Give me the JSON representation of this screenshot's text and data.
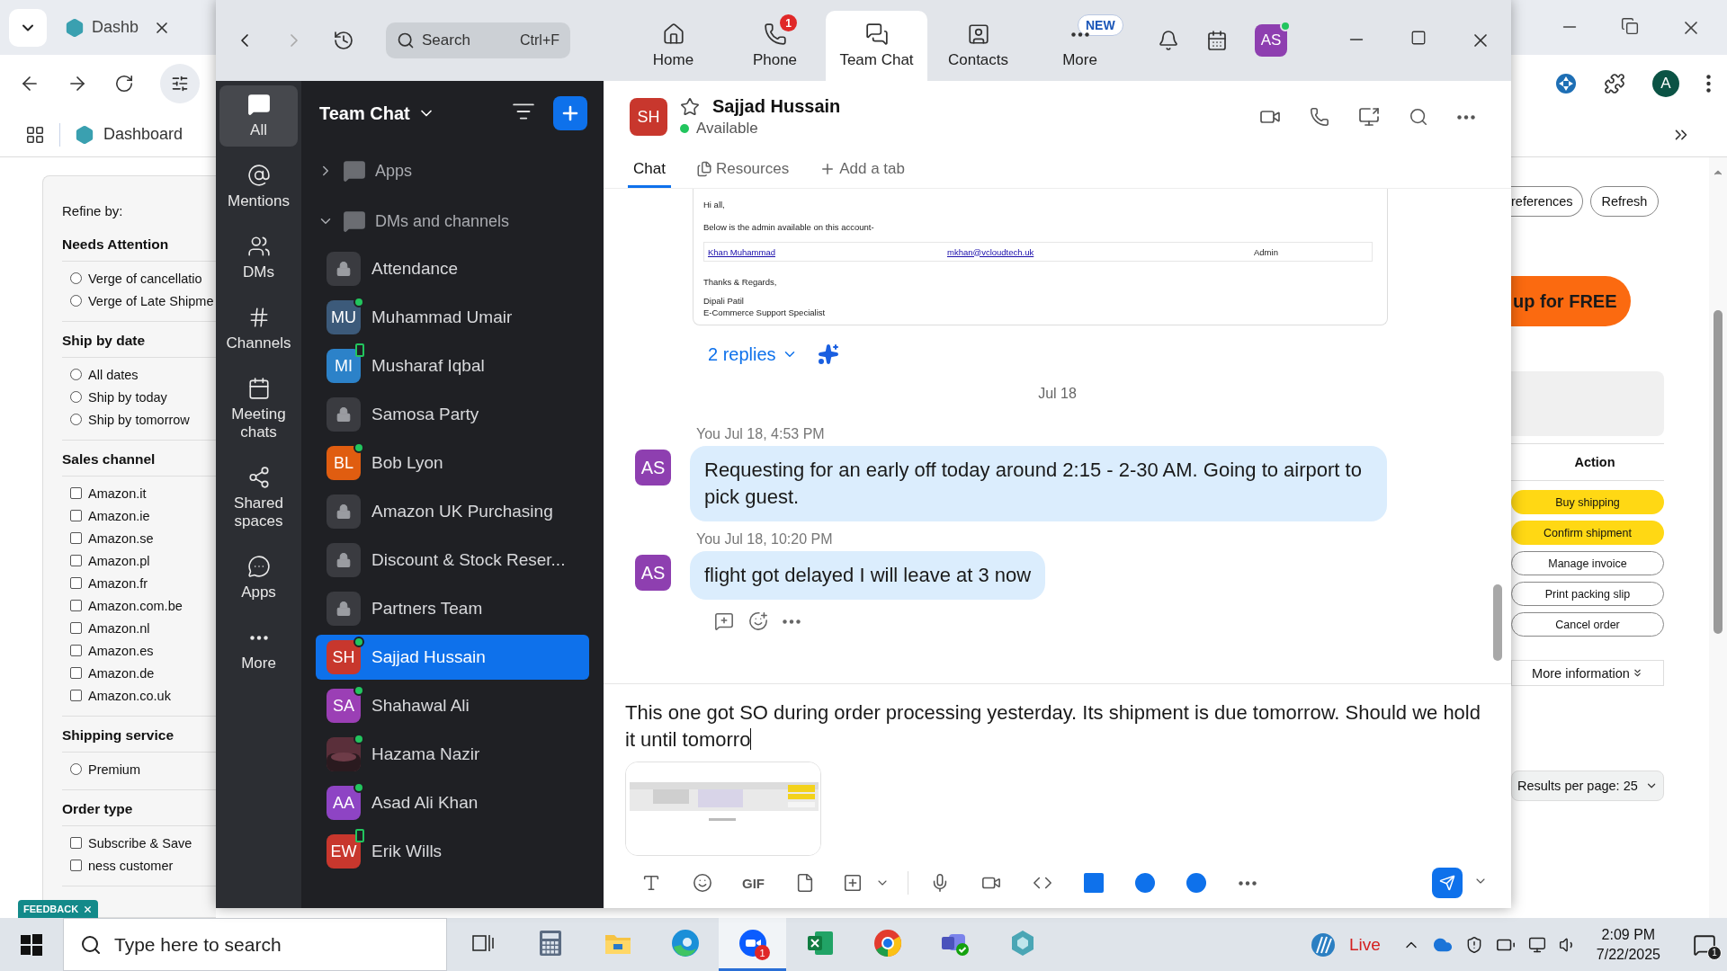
{
  "browser": {
    "tab_title": "Dashb",
    "bookmark": "Dashboard",
    "profile": "A",
    "refine": {
      "title": "Refine by:",
      "sections": [
        {
          "title": "Needs Attention",
          "kind": "radio",
          "options": [
            {
              "label": "Verge of cancellatio",
              "checked": false
            },
            {
              "label": "Verge of Late Shipme",
              "checked": false
            }
          ]
        },
        {
          "title": "Ship by date",
          "kind": "radio",
          "options": [
            {
              "label": "All dates",
              "checked": false
            },
            {
              "label": "Ship by today",
              "checked": false
            },
            {
              "label": "Ship by tomorrow",
              "checked": false
            }
          ]
        },
        {
          "title": "Sales channel",
          "kind": "checkbox",
          "options": [
            {
              "label": "Amazon.it",
              "checked": false
            },
            {
              "label": "Amazon.ie",
              "checked": false
            },
            {
              "label": "Amazon.se",
              "checked": false
            },
            {
              "label": "Amazon.pl",
              "checked": false
            },
            {
              "label": "Amazon.fr",
              "checked": false
            },
            {
              "label": "Amazon.com.be",
              "checked": false
            },
            {
              "label": "Amazon.nl",
              "checked": false
            },
            {
              "label": "Amazon.es",
              "checked": false
            },
            {
              "label": "Amazon.de",
              "checked": false
            },
            {
              "label": "Amazon.co.uk",
              "checked": false
            }
          ]
        },
        {
          "title": "Shipping service",
          "kind": "radio",
          "options": [
            {
              "label": "Premium",
              "checked": false
            }
          ]
        },
        {
          "title": "Order type",
          "kind": "checkbox",
          "options": [
            {
              "label": "Subscribe & Save",
              "checked": false
            },
            {
              "label": "ness customer",
              "checked": false
            }
          ]
        }
      ]
    },
    "feedback": "FEEDBACK",
    "top_buttons": [
      "references",
      "Refresh"
    ],
    "promo": "up for FREE",
    "action_header": "Action",
    "actions": [
      {
        "label": "Buy shipping",
        "primary": true
      },
      {
        "label": "Confirm shipment",
        "primary": true
      },
      {
        "label": "Manage invoice",
        "primary": false
      },
      {
        "label": "Print packing slip",
        "primary": false
      },
      {
        "label": "Cancel order",
        "primary": false
      }
    ],
    "more_info": "More information",
    "results_per_page": "Results per page: 25"
  },
  "zoom": {
    "search": {
      "placeholder": "Search",
      "shortcut": "Ctrl+F"
    },
    "nav": [
      {
        "kind": "home",
        "label": "Home",
        "selected": false
      },
      {
        "kind": "phone",
        "label": "Phone",
        "selected": false,
        "badge": "1"
      },
      {
        "kind": "chat",
        "label": "Team Chat",
        "selected": true
      },
      {
        "kind": "contacts",
        "label": "Contacts",
        "selected": false
      },
      {
        "kind": "more",
        "label": "More",
        "selected": false,
        "tag": "NEW"
      }
    ],
    "user_initials": "AS",
    "rail": [
      {
        "kind": "all",
        "label": "All",
        "selected": true
      },
      {
        "kind": "mentions",
        "label": "Mentions",
        "selected": false
      },
      {
        "kind": "dms",
        "label": "DMs",
        "selected": false
      },
      {
        "kind": "channels",
        "label": "Channels",
        "selected": false
      },
      {
        "kind": "meetings",
        "label": "Meeting chats",
        "selected": false
      },
      {
        "kind": "shared",
        "label": "Shared spaces",
        "selected": false
      },
      {
        "kind": "apps",
        "label": "Apps",
        "selected": false
      },
      {
        "kind": "more",
        "label": "More",
        "selected": false
      }
    ],
    "list_title": "Team Chat",
    "groups": [
      {
        "label": "Apps",
        "expanded": false
      },
      {
        "label": "DMs and channels",
        "expanded": true
      }
    ],
    "channels": [
      {
        "kind": "channel",
        "name": "Attendance",
        "selected": false
      },
      {
        "kind": "person",
        "name": "Muhammad Umair",
        "initials": "MU",
        "color": "#3c5a7a",
        "online": true,
        "mobile": false,
        "selected": false
      },
      {
        "kind": "person",
        "name": "Musharaf Iqbal",
        "initials": "MI",
        "color": "#2c82c9",
        "online": false,
        "mobile": true,
        "selected": false
      },
      {
        "kind": "channel",
        "name": "Samosa Party",
        "selected": false
      },
      {
        "kind": "person",
        "name": "Bob Lyon",
        "initials": "BL",
        "color": "#e05d10",
        "online": true,
        "mobile": false,
        "selected": false
      },
      {
        "kind": "channel",
        "name": "Amazon UK Purchasing",
        "selected": false
      },
      {
        "kind": "channel",
        "name": "Discount & Stock Reser...",
        "selected": false
      },
      {
        "kind": "channel",
        "name": "Partners Team",
        "selected": false
      },
      {
        "kind": "person",
        "name": "Sajjad Hussain",
        "initials": "SH",
        "color": "#c8372d",
        "online": true,
        "mobile": false,
        "selected": true
      },
      {
        "kind": "person",
        "name": "Shahawal Ali",
        "initials": "SA",
        "color": "#9b3fb5",
        "online": true,
        "mobile": false,
        "selected": false
      },
      {
        "name": "Hazama Nazir",
        "online": true,
        "mobile": false,
        "selected": false
      },
      {
        "kind": "person",
        "name": "Asad Ali Khan",
        "initials": "AA",
        "color": "#8e44c4",
        "online": true,
        "mobile": false,
        "selected": false
      },
      {
        "kind": "person",
        "name": "Erik Wills",
        "initials": "EW",
        "color": "#c8372d",
        "online": false,
        "mobile": true,
        "selected": false
      }
    ],
    "chat": {
      "name": "Sajjad Hussain",
      "initials": "SH",
      "status": "Available",
      "tabs": [
        {
          "kind": "chat",
          "label": "Chat",
          "selected": true
        },
        {
          "kind": "resources",
          "label": "Resources",
          "selected": false
        },
        {
          "kind": "add",
          "label": "Add a tab",
          "selected": false
        }
      ],
      "email": {
        "greeting": "Hi all,",
        "intro": "Below is the admin available on this account-",
        "row": [
          "Khan Muhammad",
          "mkhan@vcloudtech.uk",
          "Admin"
        ],
        "closing": "Thanks & Regards,",
        "signer": "Dipali Patil",
        "role": "E-Commerce Support Specialist"
      },
      "replies": "2 replies",
      "date": "Jul 18",
      "messages": [
        {
          "sender": "You",
          "time": "Jul 18, 4:53 PM",
          "initials": "AS",
          "text": "Requesting for an early off today around 2:15 - 2-30 AM. Going to airport to pick guest."
        },
        {
          "sender": "You",
          "time": "Jul 18, 10:20 PM",
          "initials": "AS",
          "text": "flight got delayed I will leave at 3 now"
        }
      ],
      "draft": "This one got SO during order processing yesterday. Its shipment is due tomorrow. Should we hold it until tomorro",
      "gif": "GIF"
    }
  },
  "taskbar": {
    "search": {
      "placeholder": "Type here to search"
    },
    "apps": [
      {
        "kind": "task-view",
        "active": false
      },
      {
        "kind": "calculator",
        "active": false
      },
      {
        "kind": "file-explorer",
        "active": false
      },
      {
        "kind": "edge",
        "active": false
      },
      {
        "kind": "zoom",
        "active": true,
        "badge": "1"
      },
      {
        "kind": "excel",
        "active": false
      },
      {
        "kind": "chrome",
        "active": false
      },
      {
        "kind": "teams",
        "active": false
      },
      {
        "kind": "hexagon",
        "active": false
      }
    ],
    "weather": "Live",
    "time": "2:09 PM",
    "date": "7/22/2025",
    "notifications": "1"
  }
}
